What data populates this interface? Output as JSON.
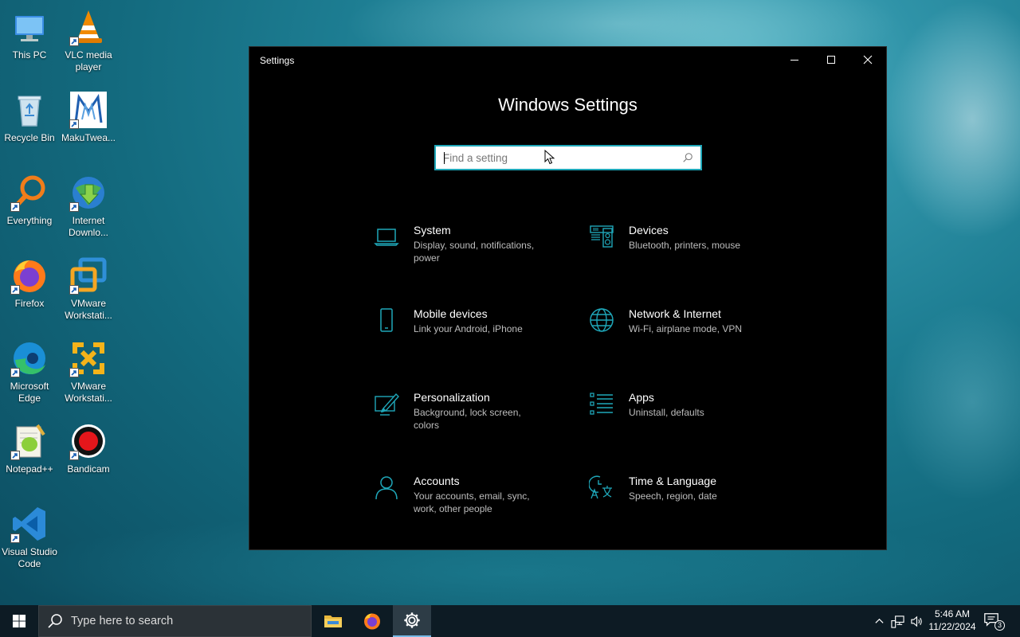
{
  "desktop": {
    "icons": [
      {
        "label": "This PC",
        "icon": "this-pc-icon"
      },
      {
        "label": "VLC media player",
        "icon": "vlc-icon"
      },
      {
        "label": "Recycle Bin",
        "icon": "recycle-bin-icon"
      },
      {
        "label": "MakuTwea...",
        "icon": "makutweaker-icon"
      },
      {
        "label": "Everything",
        "icon": "everything-search-icon"
      },
      {
        "label": "Internet Downlo...",
        "icon": "internet-download-manager-icon"
      },
      {
        "label": "Firefox",
        "icon": "firefox-icon"
      },
      {
        "label": "VMware Workstati...",
        "icon": "vmware-workstation-icon"
      },
      {
        "label": "Microsoft Edge",
        "icon": "edge-icon"
      },
      {
        "label": "VMware Workstati...",
        "icon": "vmware-player-icon"
      },
      {
        "label": "Notepad++",
        "icon": "notepadpp-icon"
      },
      {
        "label": "Bandicam",
        "icon": "bandicam-icon"
      },
      {
        "label": "Visual Studio Code",
        "icon": "vscode-icon"
      }
    ]
  },
  "window": {
    "title": "Settings",
    "heading": "Windows Settings",
    "search_placeholder": "Find a setting",
    "accent": "#1fa7b9",
    "categories": [
      {
        "name": "System",
        "desc": "Display, sound, notifications, power",
        "icon": "laptop-icon"
      },
      {
        "name": "Devices",
        "desc": "Bluetooth, printers, mouse",
        "icon": "devices-icon"
      },
      {
        "name": "Mobile devices",
        "desc": "Link your Android, iPhone",
        "icon": "phone-icon"
      },
      {
        "name": "Network & Internet",
        "desc": "Wi-Fi, airplane mode, VPN",
        "icon": "globe-icon"
      },
      {
        "name": "Personalization",
        "desc": "Background, lock screen, colors",
        "icon": "personalization-icon"
      },
      {
        "name": "Apps",
        "desc": "Uninstall, defaults",
        "icon": "apps-list-icon"
      },
      {
        "name": "Accounts",
        "desc": "Your accounts, email, sync, work, other people",
        "icon": "person-icon"
      },
      {
        "name": "Time & Language",
        "desc": "Speech, region, date",
        "icon": "time-language-icon"
      }
    ]
  },
  "taskbar": {
    "search_placeholder": "Type here to search",
    "time": "5:46 AM",
    "date": "11/22/2024",
    "notification_count": "3",
    "pinned": [
      "file-explorer-icon",
      "firefox-icon",
      "settings-gear-icon"
    ]
  }
}
